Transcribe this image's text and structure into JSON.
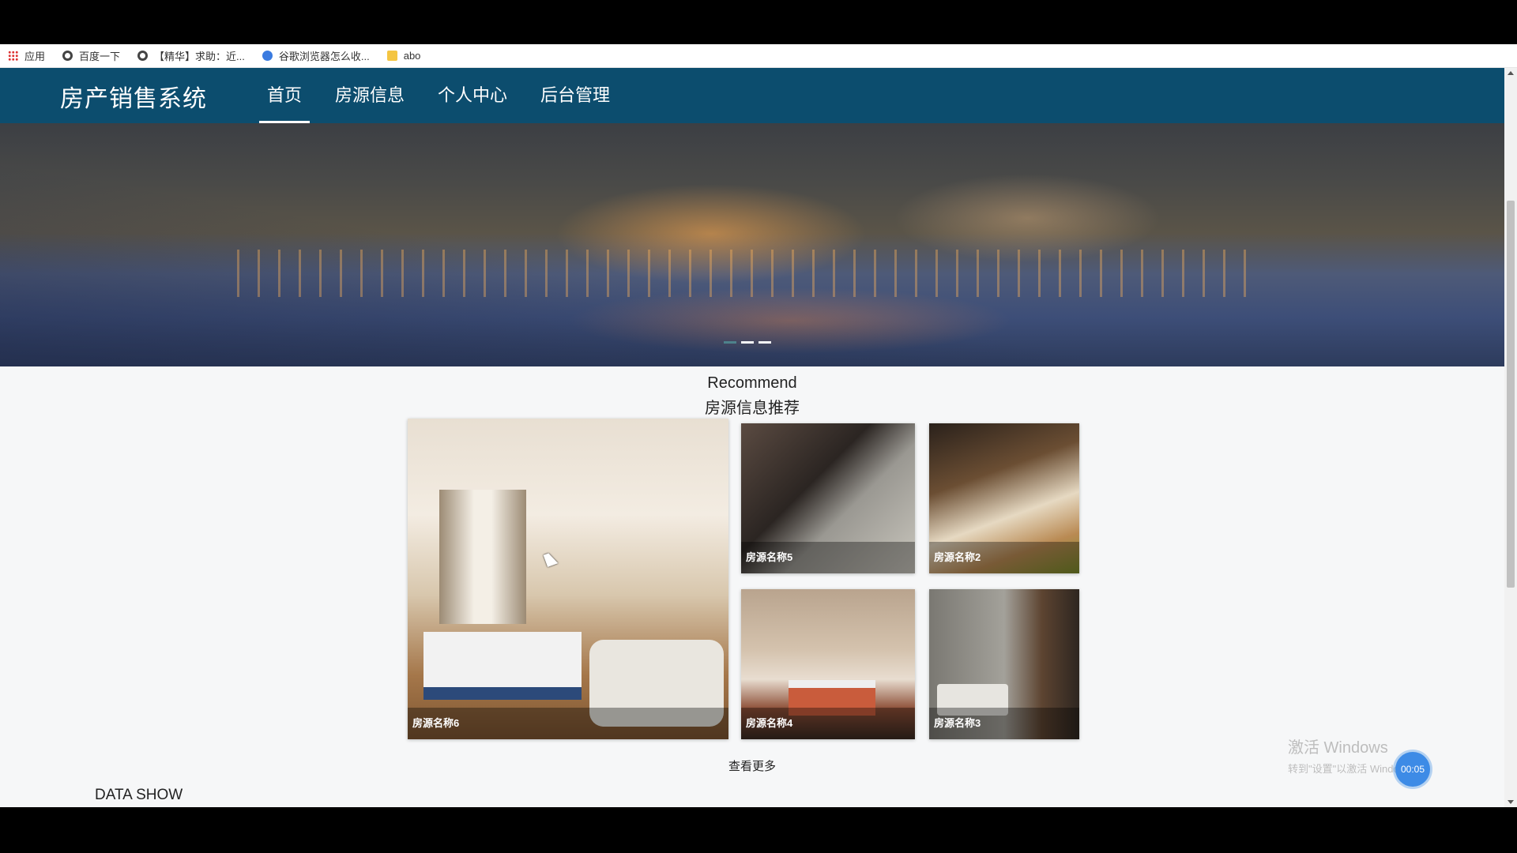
{
  "bookmarks": [
    {
      "label": "应用",
      "icon": "apps-grid-icon"
    },
    {
      "label": "百度一下",
      "icon": "globe-icon"
    },
    {
      "label": "【精华】求助：近...",
      "icon": "globe-icon"
    },
    {
      "label": "谷歌浏览器怎么收...",
      "icon": "baidu-paw-icon"
    },
    {
      "label": "abo",
      "icon": "folder-icon"
    }
  ],
  "nav": {
    "brand": "房产销售系统",
    "items": [
      {
        "label": "首页",
        "active": true
      },
      {
        "label": "房源信息",
        "active": false
      },
      {
        "label": "个人中心",
        "active": false
      },
      {
        "label": "后台管理",
        "active": false
      }
    ]
  },
  "banner": {
    "slide_count": 3,
    "active_slide": 2
  },
  "recommend": {
    "title_en": "Recommend",
    "title_cn": "房源信息推荐",
    "cards": [
      {
        "name": "房源名称6"
      },
      {
        "name": "房源名称5"
      },
      {
        "name": "房源名称2"
      },
      {
        "name": "房源名称4"
      },
      {
        "name": "房源名称3"
      }
    ],
    "more": "查看更多"
  },
  "data_show": {
    "title": "DATA SHOW"
  },
  "watermark": {
    "line1": "激活 Windows",
    "line2": "转到\"设置\"以激活 Windows。"
  },
  "timer": "00:05",
  "colors": {
    "nav_bg": "#0c4d6e",
    "page_bg": "#f6f7f8"
  }
}
